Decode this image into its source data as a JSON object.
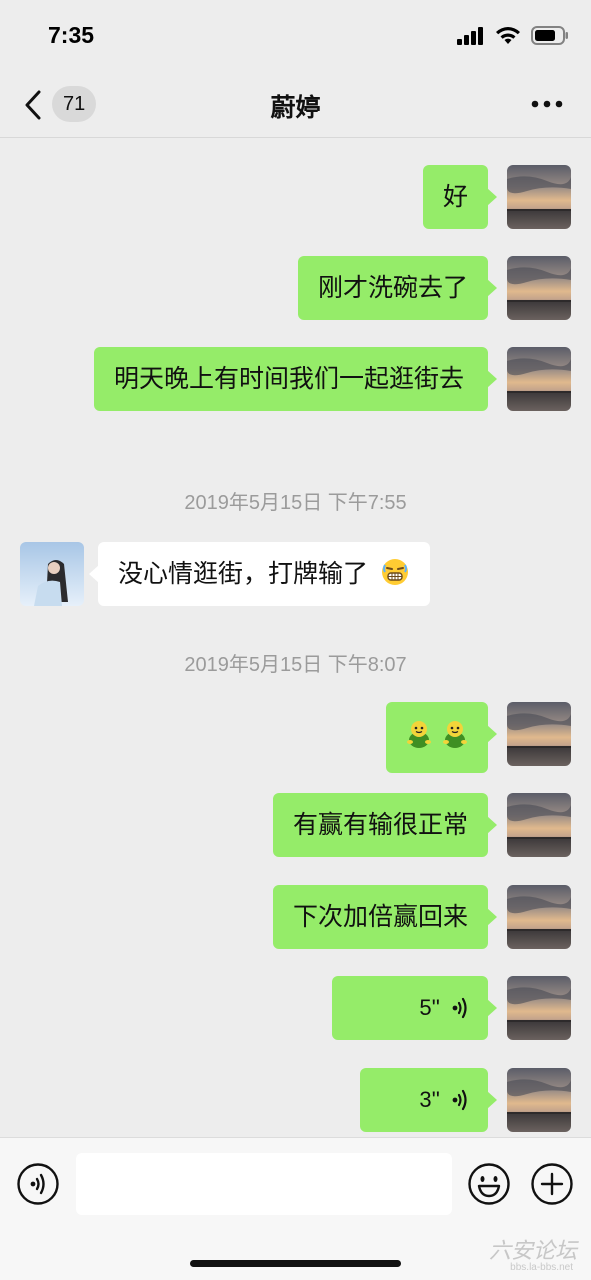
{
  "status_bar": {
    "time": "7:35"
  },
  "nav": {
    "unread_count": "71",
    "title": "蔚婷"
  },
  "messages": [
    {
      "sender": "me",
      "text": "好"
    },
    {
      "sender": "me",
      "text": "刚才洗碗去了"
    },
    {
      "sender": "me",
      "text": "明天晚上有时间我们一起逛街去"
    },
    {
      "sender": "other",
      "text": "没心情逛街，打牌输了",
      "emoji": "grimacing-face"
    },
    {
      "sender": "me",
      "emoji": [
        "frog-emoji",
        "frog-emoji"
      ]
    },
    {
      "sender": "me",
      "text": "有赢有输很正常"
    },
    {
      "sender": "me",
      "text": "下次加倍赢回来"
    },
    {
      "sender": "me",
      "type": "voice",
      "duration": "5''"
    },
    {
      "sender": "me",
      "type": "voice",
      "duration": "3''"
    }
  ],
  "timestamps": [
    "2019年5月15日 下午7:55",
    "2019年5月15日 下午8:07"
  ],
  "input": {
    "placeholder": ""
  },
  "watermark": {
    "text": "六安论坛",
    "sub": "bbs.la-bbs.net"
  },
  "colors": {
    "my_bubble": "#95ec69",
    "other_bubble": "#ffffff",
    "background": "#ededed"
  }
}
